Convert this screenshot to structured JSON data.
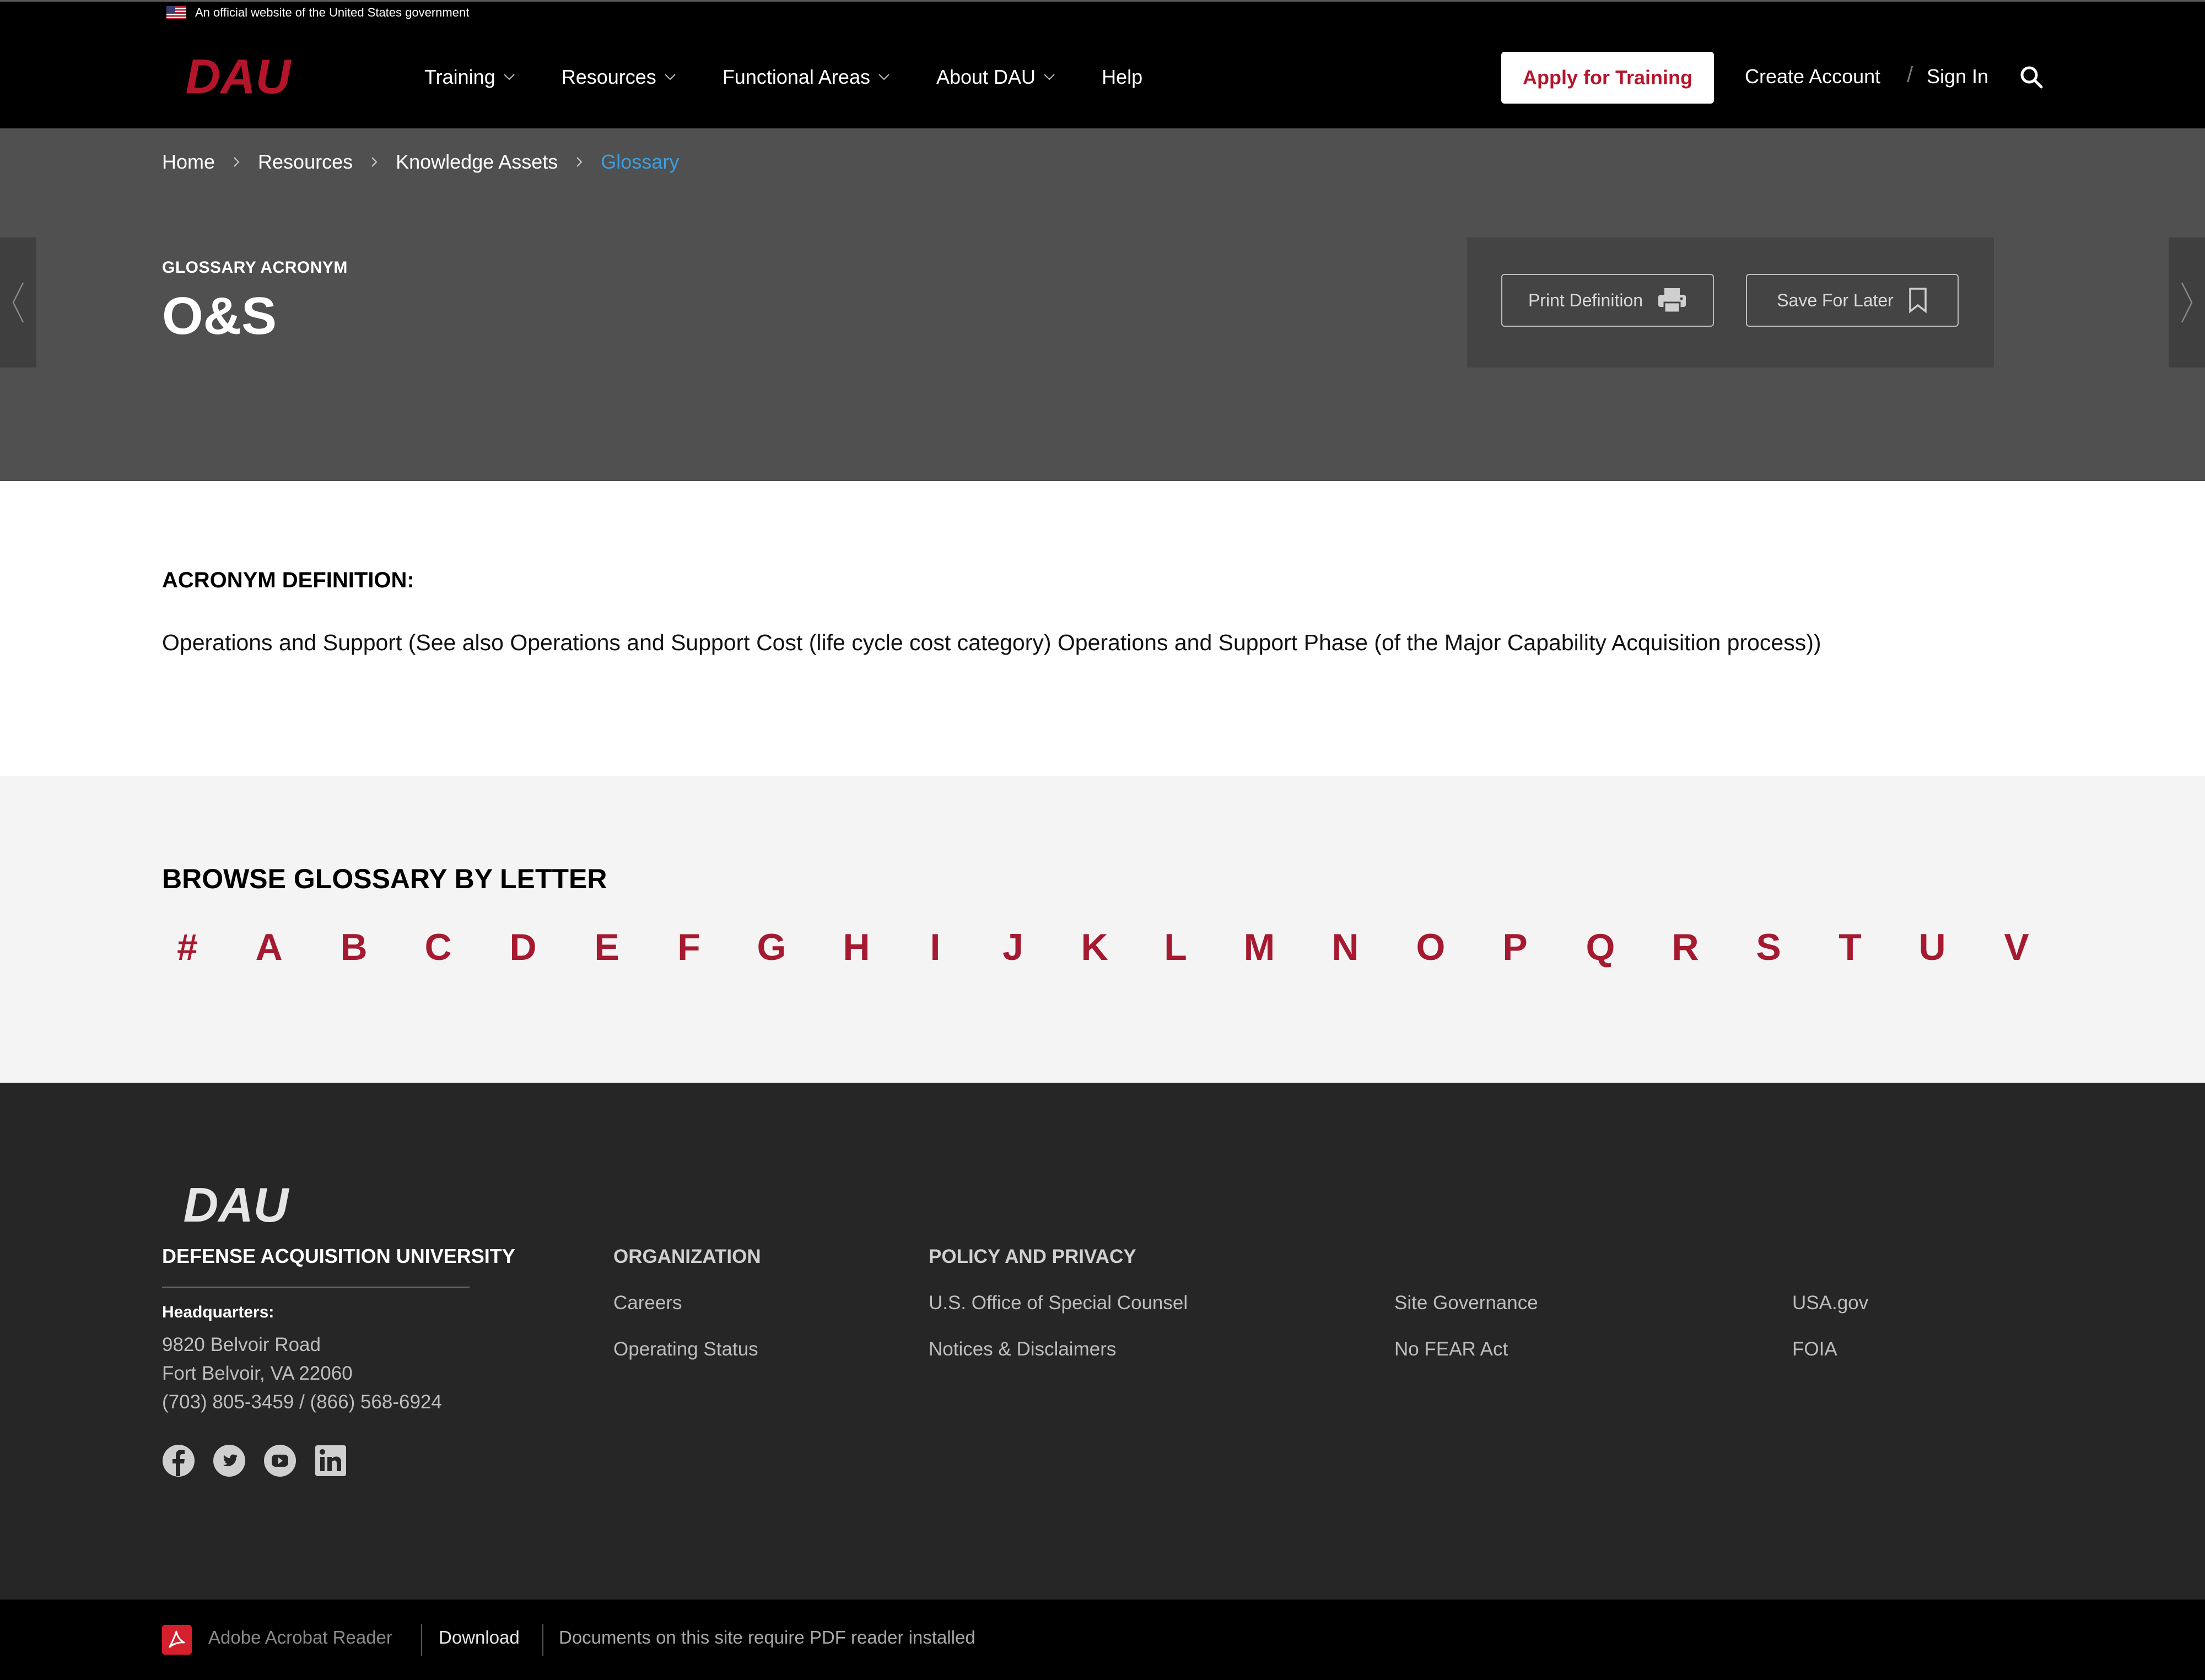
{
  "gov_banner": {
    "text": "An official website of the United States government"
  },
  "header": {
    "logo_text": "DAU",
    "nav": [
      {
        "label": "Training"
      },
      {
        "label": "Resources"
      },
      {
        "label": "Functional Areas"
      },
      {
        "label": "About DAU"
      },
      {
        "label": "Help"
      }
    ],
    "apply_label": "Apply for Training",
    "create_account": "Create Account",
    "separator": "/",
    "sign_in": "Sign In",
    "search_icon": "search-icon"
  },
  "breadcrumb": [
    "Home",
    "Resources",
    "Knowledge Assets",
    "Glossary"
  ],
  "hero": {
    "label": "GLOSSARY ACRONYM",
    "title": "O&S",
    "print_label": "Print Definition",
    "save_label": "Save For Later"
  },
  "definition": {
    "heading": "ACRONYM DEFINITION:",
    "text": "Operations and Support (See also Operations and Support Cost (life cycle cost category) Operations and Support Phase (of the Major Capability Acquisition process))"
  },
  "browse": {
    "heading": "BROWSE GLOSSARY BY LETTER",
    "letters": [
      "#",
      "A",
      "B",
      "C",
      "D",
      "E",
      "F",
      "G",
      "H",
      "I",
      "J",
      "K",
      "L",
      "M",
      "N",
      "O",
      "P",
      "Q",
      "R",
      "S",
      "T",
      "U",
      "V"
    ]
  },
  "footer": {
    "logo_text": "DAU",
    "university": "DEFENSE ACQUISITION UNIVERSITY",
    "hq_label": "Headquarters:",
    "address": [
      "9820 Belvoir Road",
      "Fort Belvoir, VA 22060",
      "(703) 805-3459 / (866) 568-6924"
    ],
    "socials": [
      "facebook-icon",
      "twitter-icon",
      "youtube-icon",
      "linkedin-icon"
    ],
    "organization": {
      "heading": "ORGANIZATION",
      "links": [
        "Careers",
        "Operating Status"
      ]
    },
    "policy": {
      "heading": "POLICY AND PRIVACY",
      "col1": [
        "U.S. Office of Special Counsel",
        "Notices & Disclaimers"
      ],
      "col2": [
        "Site Governance",
        "No FEAR Act"
      ],
      "col3": [
        "USA.gov",
        "FOIA"
      ]
    }
  },
  "bottom_bar": {
    "reader": "Adobe Acrobat Reader",
    "download": "Download",
    "note": "Documents on this site require PDF reader installed"
  },
  "colors": {
    "brand_red": "#b5152b",
    "letter_red": "#a51a30",
    "hero_bg": "#505050",
    "footer_bg": "#262626",
    "active_crumb": "#3c9ee0"
  }
}
